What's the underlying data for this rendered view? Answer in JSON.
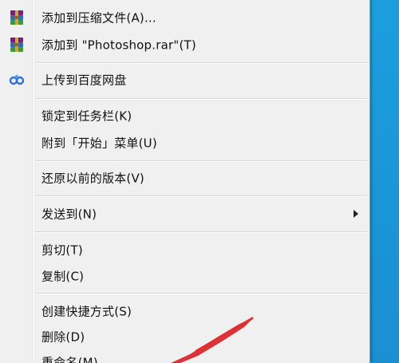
{
  "context_menu": {
    "items": [
      {
        "label": "添加到压缩文件(A)...",
        "icon": "winrar-archive-icon"
      },
      {
        "label": "添加到 \"Photoshop.rar\"(T)",
        "icon": "winrar-archive-icon"
      },
      {
        "label": "上传到百度网盘",
        "icon": "baidu-netdisk-icon"
      },
      {
        "label": "锁定到任务栏(K)"
      },
      {
        "label": "附到「开始」菜单(U)"
      },
      {
        "label": "还原以前的版本(V)"
      },
      {
        "label": "发送到(N)",
        "submenu": true
      },
      {
        "label": "剪切(T)"
      },
      {
        "label": "复制(C)"
      },
      {
        "label": "创建快捷方式(S)"
      },
      {
        "label": "删除(D)"
      },
      {
        "label": "重命名(M)"
      }
    ]
  },
  "colors": {
    "menu_background": "#f0f0f0",
    "desktop_background": "#1c9ede",
    "annotation_arrow": "#d9232a"
  }
}
